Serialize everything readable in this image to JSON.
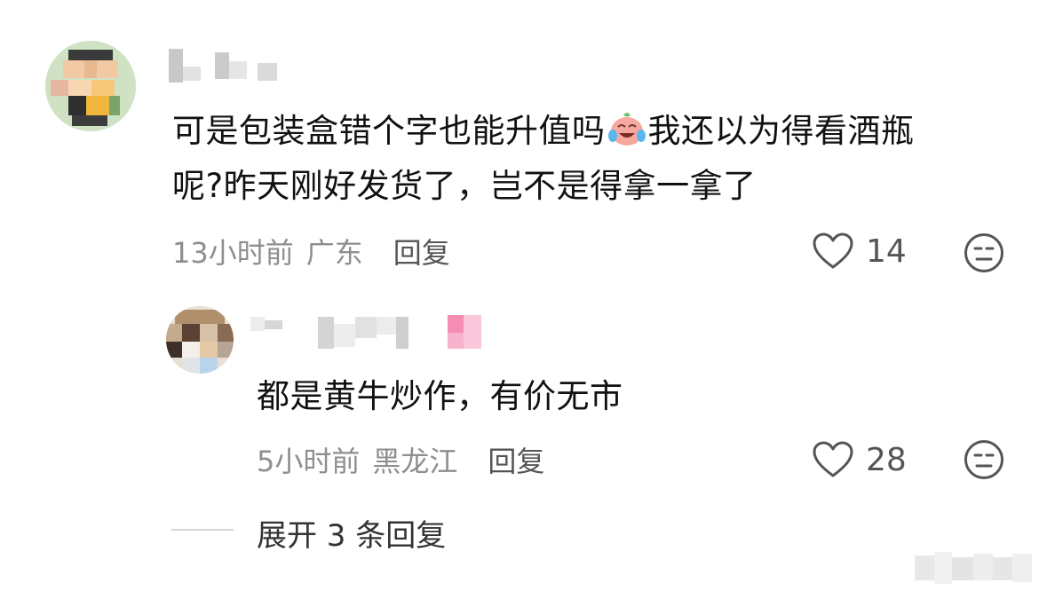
{
  "main_comment": {
    "text_line1_before_emoji": "可是包装盒错个字也能升值吗",
    "emoji_name": "crying-laughing-face-emoji",
    "text_line1_after_emoji": "我还以为得看酒瓶",
    "text_line2": "呢?昨天刚好发货了，岂不是得拿一拿了",
    "time": "13小时前",
    "location": "广东",
    "reply_label": "回复",
    "like_count": "14"
  },
  "reply_comment": {
    "text": "都是黄牛炒作，有价无市",
    "time": "5小时前",
    "location": "黑龙江",
    "reply_label": "回复",
    "like_count": "28"
  },
  "expand_replies": {
    "label": "展开 3 条回复"
  },
  "colors": {
    "meta_gray": "#8e8e8e",
    "icon_gray": "#555555",
    "text_dark": "#111111"
  }
}
